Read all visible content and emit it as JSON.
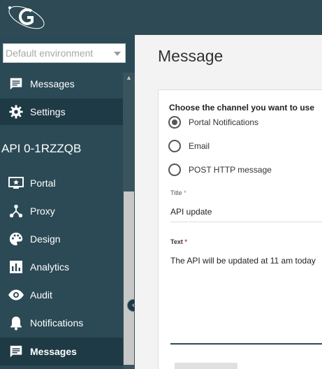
{
  "sidebar": {
    "environment": {
      "selected": "Default environment"
    },
    "top_items": [
      {
        "label": "Messages",
        "icon": "message-icon"
      },
      {
        "label": "Settings",
        "icon": "gear-icon"
      }
    ],
    "api_title": "API 0-1RZZQB",
    "api_items": [
      {
        "label": "Portal",
        "icon": "portal-icon"
      },
      {
        "label": "Proxy",
        "icon": "proxy-icon"
      },
      {
        "label": "Design",
        "icon": "palette-icon"
      },
      {
        "label": "Analytics",
        "icon": "analytics-icon"
      },
      {
        "label": "Audit",
        "icon": "eye-icon"
      },
      {
        "label": "Notifications",
        "icon": "bell-icon"
      },
      {
        "label": "Messages",
        "icon": "message-icon"
      }
    ]
  },
  "main": {
    "title": "Message",
    "channel_label": "Choose the channel you want to use",
    "channels": [
      {
        "label": "Portal Notifications",
        "selected": true
      },
      {
        "label": "Email",
        "selected": false
      },
      {
        "label": "POST HTTP message",
        "selected": false
      }
    ],
    "title_field": {
      "label": "Title",
      "required_mark": "*",
      "value": "API update"
    },
    "text_field": {
      "label": "Text",
      "required_mark": "*",
      "value": "The API will be updated at 11 am today"
    }
  },
  "colors": {
    "sidebar_bg": "#2b4a55",
    "active_item_bg": "#1e3a44",
    "main_bg": "#f3f3f3",
    "required_red": "#d32f2f"
  }
}
